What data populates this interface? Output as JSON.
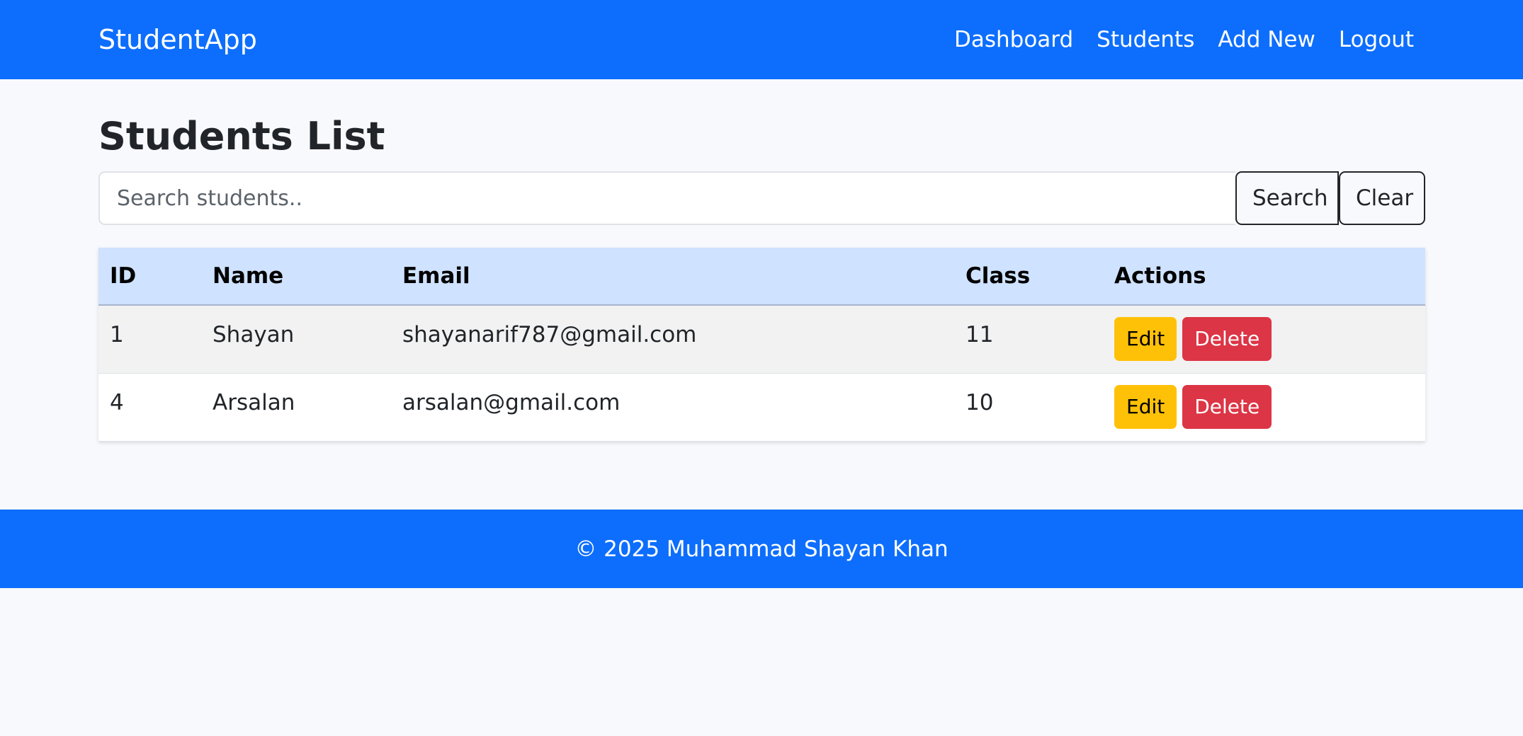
{
  "navbar": {
    "brand": "StudentApp",
    "links": [
      "Dashboard",
      "Students",
      "Add New",
      "Logout"
    ]
  },
  "page": {
    "title": "Students List"
  },
  "search": {
    "placeholder": "Search students..",
    "value": "",
    "search_label": "Search",
    "clear_label": "Clear"
  },
  "table": {
    "headers": [
      "ID",
      "Name",
      "Email",
      "Class",
      "Actions"
    ],
    "rows": [
      {
        "id": "1",
        "name": "Shayan",
        "email": "shayanarif787@gmail.com",
        "class": "11"
      },
      {
        "id": "4",
        "name": "Arsalan",
        "email": "arsalan@gmail.com",
        "class": "10"
      }
    ],
    "edit_label": "Edit",
    "delete_label": "Delete"
  },
  "footer": {
    "text": "© 2025 Muhammad Shayan Khan"
  },
  "colors": {
    "primary": "#0d6efd",
    "table_header": "#cfe2ff",
    "edit": "#ffc107",
    "delete": "#dc3545"
  }
}
